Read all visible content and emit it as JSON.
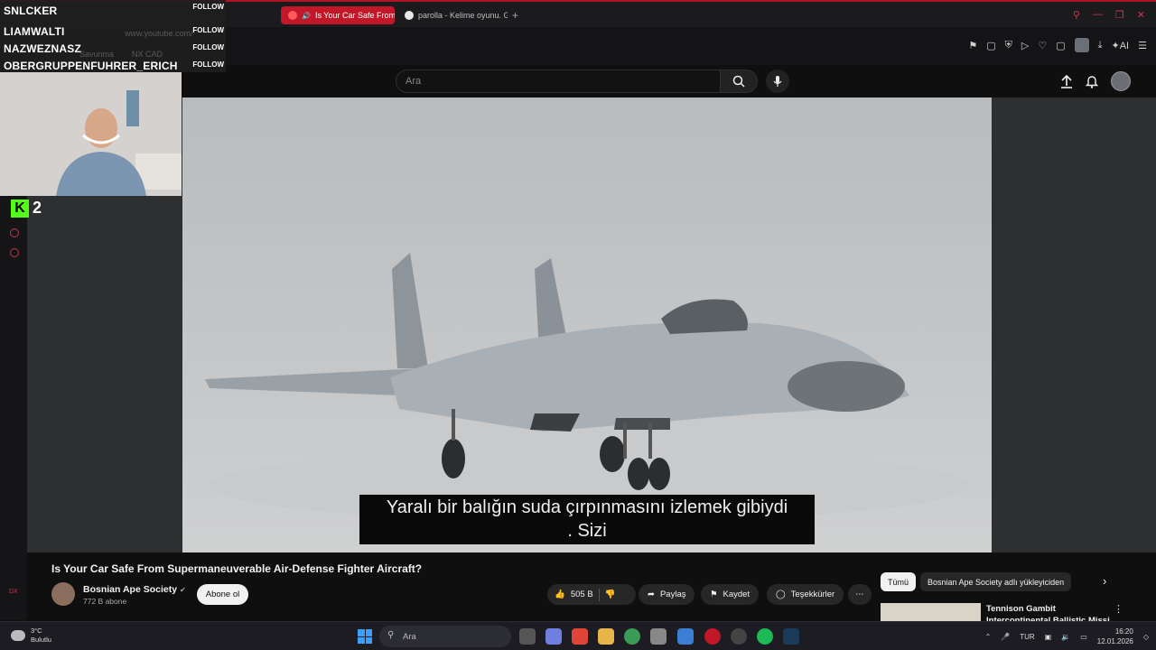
{
  "browser": {
    "tabs": [
      {
        "label": "Is Your Car Safe From",
        "active": true
      },
      {
        "label": "parolla - Kelime oyunu. Gü",
        "active": false
      }
    ],
    "new_tab": "+"
  },
  "overlay": {
    "followers": [
      {
        "name": "SNLCKER",
        "action": "FOLLOW"
      },
      {
        "name": "LIAMWALTI",
        "action": "FOLLOW"
      },
      {
        "name": "NAZWEZNASZ",
        "action": "FOLLOW"
      },
      {
        "name": "OBERGRUPPENFUHRER_ERICH",
        "action": "FOLLOW"
      }
    ],
    "ghost_texts": [
      "www.youtube.com/",
      "Savunma",
      "NX CAD"
    ],
    "kick_viewers": "2",
    "side_label": "DX"
  },
  "youtube": {
    "search_placeholder": "Ara",
    "video": {
      "subtitle_line1": "Yaralı bir balığın suda çırpınmasını izlemek gibiydi",
      "subtitle_line2": ". Sizi",
      "title": "Is Your Car Safe From Supermaneuverable Air-Defense Fighter Aircraft?"
    },
    "channel": {
      "name": "Bosnian Ape Society",
      "subscribers": "772 B abone",
      "subscribe_label": "Abone ol"
    },
    "actions": {
      "likes": "505 B",
      "share": "Paylaş",
      "save": "Kaydet",
      "thanks": "Teşekkürler",
      "more": "⋯"
    },
    "chips": [
      "Tümü",
      "Bosnian Ape Society adlı yükleyiciden"
    ],
    "recommendation": {
      "title": "Tennison Gambit Intercontinental Ballistic Missi"
    }
  },
  "taskbar": {
    "weather_temp": "3°C",
    "weather_desc": "Bulutlu",
    "search_label": "Ara",
    "language": "TUR",
    "time": "16:20",
    "date": "12.01.2026"
  },
  "colors": {
    "accent": "#c11729",
    "kick_green": "#53fc18"
  }
}
